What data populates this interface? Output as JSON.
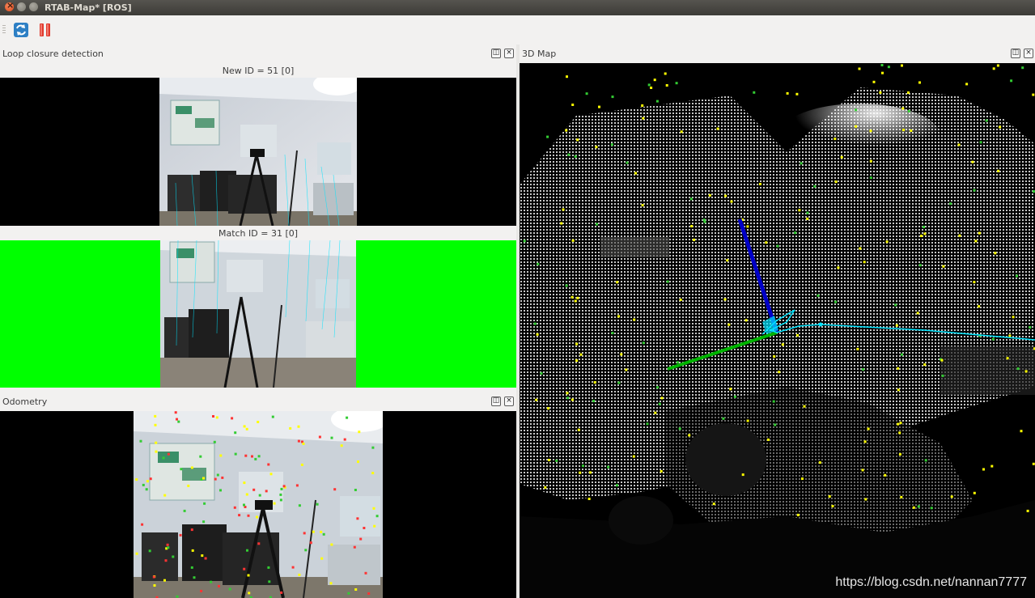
{
  "window": {
    "title": "RTAB-Map* [ROS]"
  },
  "toolbar": {
    "buttons": [
      {
        "name": "refresh-icon"
      },
      {
        "name": "pause-icon"
      }
    ]
  },
  "docks": {
    "loop_closure": {
      "title": "Loop closure detection",
      "new_id_caption": "New ID = 51 [0]",
      "match_id_caption": "Match ID = 31 [0]",
      "match_highlight_color": "#00ff00"
    },
    "odometry": {
      "title": "Odometry"
    },
    "map3d": {
      "title": "3D Map"
    }
  },
  "watermark": "https://blog.csdn.net/nannan7777",
  "colors": {
    "titlebar": "#3c3b37",
    "window_bg": "#f2f1f0",
    "close_button": "#e0491a",
    "loop_match_bg": "#00ff00",
    "axis_blue": "#0000c8",
    "axis_green": "#00b400",
    "trajectory_cyan": "#00e5ff",
    "feature_yellow": "#ffff00"
  }
}
